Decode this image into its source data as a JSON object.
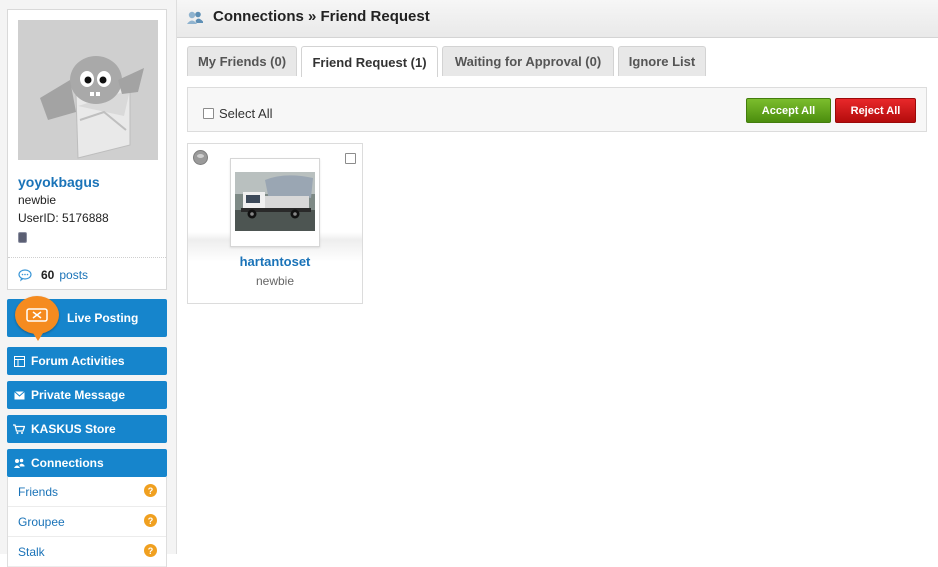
{
  "profile": {
    "username": "yoyokbagus",
    "rank": "newbie",
    "userid": "UserID: 5176888",
    "posts_count": "60",
    "posts_label": "posts"
  },
  "nav": {
    "live_posting": "Live Posting",
    "forum_activities": "Forum Activities",
    "private_message": "Private Message",
    "kaskus_store": "KASKUS Store",
    "connections": "Connections"
  },
  "submenu": [
    {
      "label": "Friends",
      "badge": "?"
    },
    {
      "label": "Groupee",
      "badge": "?"
    },
    {
      "label": "Stalk",
      "badge": "?"
    }
  ],
  "header": {
    "title": "Connections » Friend Request"
  },
  "tabs": [
    {
      "label": "My Friends (0)"
    },
    {
      "label": "Friend Request (1)"
    },
    {
      "label": "Waiting for Approval (0)"
    },
    {
      "label": "Ignore List"
    }
  ],
  "toolbar": {
    "select_all": "Select All",
    "accept_all": "Accept All",
    "reject_all": "Reject All"
  },
  "requests": [
    {
      "name": "hartantoset",
      "rank": "newbie"
    }
  ],
  "colors": {
    "accent": "#1685cc",
    "link": "#1a73b8",
    "accept": "#5fa41b",
    "reject": "#d01515",
    "badge": "#f0a020"
  }
}
